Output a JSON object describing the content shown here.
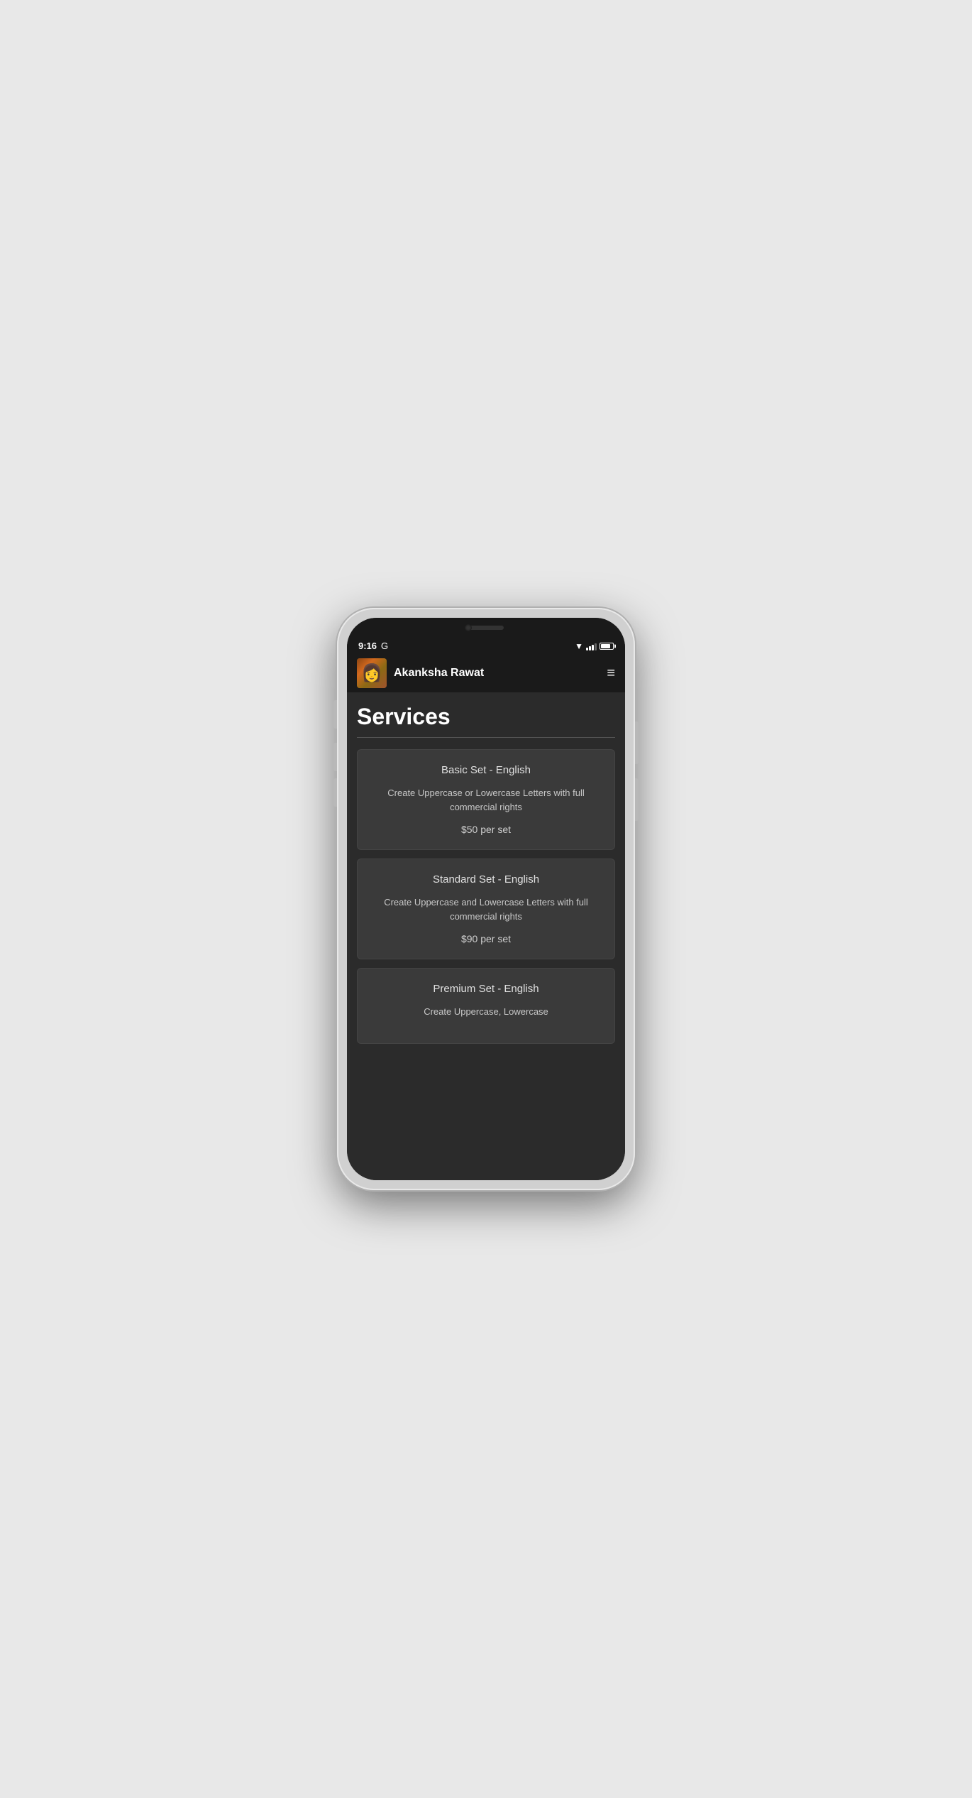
{
  "status_bar": {
    "time": "9:16",
    "carrier": "G"
  },
  "header": {
    "user_name": "Akanksha Rawat",
    "menu_icon": "≡"
  },
  "page": {
    "title": "Services"
  },
  "services": [
    {
      "name": "Basic Set - English",
      "description": "Create Uppercase or Lowercase Letters with full commercial rights",
      "price": "$50 per set"
    },
    {
      "name": "Standard Set - English",
      "description": "Create Uppercase and Lowercase Letters with full commercial rights",
      "price": "$90 per set"
    },
    {
      "name": "Premium Set - English",
      "description": "Create Uppercase, Lowercase",
      "price": ""
    }
  ]
}
